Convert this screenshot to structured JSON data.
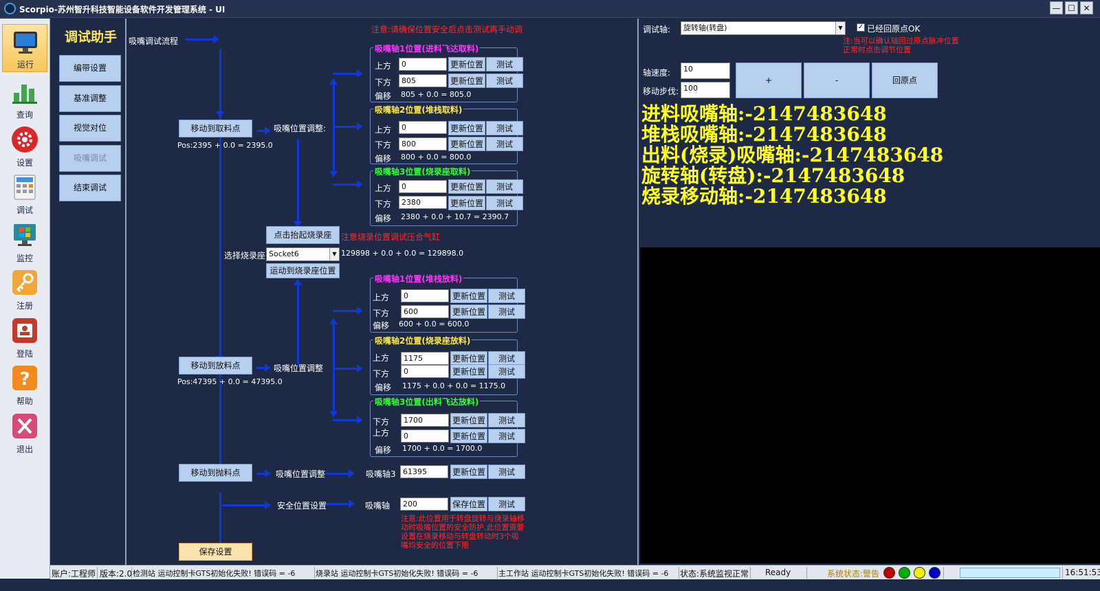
{
  "window": {
    "title": "Scorpio-苏州智升科技智能设备软件开发管理系统 - UI",
    "min": "—",
    "max": "☐",
    "close": "✕"
  },
  "sidebar": {
    "items": [
      {
        "label": "运行",
        "icon": "monitor-icon"
      },
      {
        "label": "查询",
        "icon": "bar-chart-icon"
      },
      {
        "label": "设置",
        "icon": "gear-icon"
      },
      {
        "label": "调试",
        "icon": "calculator-icon"
      },
      {
        "label": "监控",
        "icon": "windows-monitor-icon"
      },
      {
        "label": "注册",
        "icon": "key-icon"
      },
      {
        "label": "登陆",
        "icon": "login-badge-icon"
      },
      {
        "label": "帮助",
        "icon": "help-icon"
      },
      {
        "label": "退出",
        "icon": "exit-icon"
      }
    ]
  },
  "nav": {
    "title": "调试助手",
    "buttons": [
      "编带设置",
      "基准调整",
      "视觉对位",
      "吸嘴调试",
      "结束调试"
    ]
  },
  "main": {
    "flow_title": "吸嘴调试流程",
    "warn_top": "注意:请确保位置安全后点击测试再手动调",
    "move_pick": "移动到取料点",
    "pick_pos": "Pos:2395 + 0.0 = 2395.0",
    "nozzle_adjust": "吸嘴位置调整:",
    "nozzle_adjust2": "吸嘴位置调整",
    "lift_socket": "点击抬起烧录座",
    "lift_warn": "注意烧录位置调试压合气缸",
    "select_socket_label": "选择烧录座",
    "select_socket_value": "Socket6",
    "socket_calc": "129898 + 0.0 + 0.0 = 129898.0",
    "move_socket": "运动到烧录座位置",
    "move_place": "移动到放料点",
    "place_pos": "Pos:47395 + 0.0 = 47395.0",
    "move_throw": "移动到抛料点",
    "nozzle3_label": "吸嘴轴3",
    "nozzle3_value": "61395",
    "safe_label": "安全位置设置",
    "nozzle_label": "吸嘴轴",
    "safe_value": "200",
    "save_pos": "保存位置",
    "update": "更新位置",
    "test": "测试",
    "up": "上方",
    "down": "下方",
    "offset": "偏移",
    "safe_warn": "注意:此位置用于转盘旋转与烧录轴移动时吸嘴位置的安全防护,此位置需要设置在烧录移动与转盘转动时3个吸嘴均安全的位置下限",
    "save_settings": "保存设置",
    "groups": [
      {
        "title": "吸嘴轴1位置(进料飞达取料)",
        "color": "#ff33ff",
        "r1": "0",
        "r2": "805",
        "calc": "805 + 0.0 = 805.0",
        "l1": "上方",
        "l2": "下方"
      },
      {
        "title": "吸嘴轴2位置(堆栈取料)",
        "color": "#ffe84a",
        "r1": "0",
        "r2": "800",
        "calc": "800 + 0.0 = 800.0",
        "l1": "上方",
        "l2": "下方"
      },
      {
        "title": "吸嘴轴3位置(烧录座取料)",
        "color": "#33ff33",
        "r1": "0",
        "r2": "2380",
        "calc": "2380 + 0.0 + 10.7 = 2390.7",
        "l1": "上方",
        "l2": "下方"
      },
      {
        "title": "吸嘴轴1位置(堆栈放料)",
        "color": "#ff33ff",
        "r1": "0",
        "r2": "600",
        "calc": "600 + 0.0 = 600.0",
        "l1": "上方",
        "l2": "下方"
      },
      {
        "title": "吸嘴轴2位置(烧录座放料)",
        "color": "#ffe84a",
        "r1": "1175",
        "r2": "0",
        "calc": "1175 + 0.0 + 0.0 = 1175.0",
        "l1": "上方",
        "l2": "下方"
      },
      {
        "title": "吸嘴轴3位置(出料飞达放料)",
        "color": "#33ff33",
        "r1": "1700",
        "r2": "0",
        "calc": "1700 + 0.0 = 1700.0",
        "l1": "下方",
        "l2": "上方"
      }
    ]
  },
  "right": {
    "axis_label": "调试轴:",
    "axis_value": "旋转轴(转盘)",
    "homed_label": "已经回原点OK",
    "home_warn": "注:当可以确认轴回过原点脉冲位置正常时点击调节位置",
    "speed_label": "轴速度:",
    "speed_value": "10",
    "step_label": "移动步伐:",
    "step_value": "100",
    "plus": "+",
    "minus": "-",
    "home": "回原点",
    "readouts": [
      "进料吸嘴轴:-2147483648",
      "堆栈吸嘴轴:-2147483648",
      "出料(烧录)吸嘴轴:-2147483648",
      "旋转轴(转盘):-2147483648",
      "烧录移动轴:-2147483648"
    ]
  },
  "status": {
    "account": "账户:工程师",
    "version": "版本:2.0",
    "err1": "检测站 运动控制卡GTS初始化失败! 错误码 = -6",
    "err2": "烧录站 运动控制卡GTS初始化失败! 错误码 = -6",
    "err3": "主工作站 运动控制卡GTS初始化失败! 错误码 = -6",
    "state": "状态:系统监视正常",
    "ready": "Ready",
    "sysstate": "系统状态:警告",
    "time": "16:51:53"
  }
}
